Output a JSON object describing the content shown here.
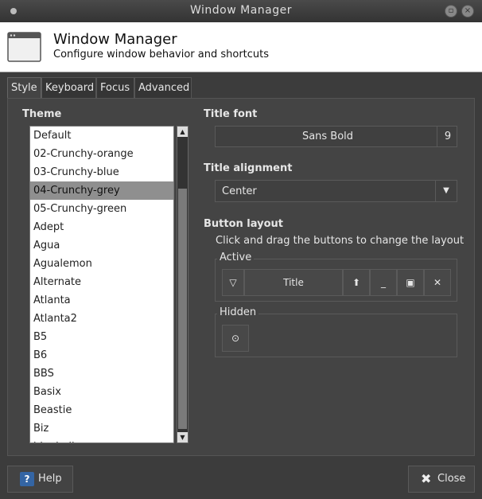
{
  "window": {
    "title": "Window Manager"
  },
  "header": {
    "title": "Window Manager",
    "subtitle": "Configure window behavior and shortcuts"
  },
  "tabs": [
    {
      "label": "Style"
    },
    {
      "label": "Keyboard"
    },
    {
      "label": "Focus"
    },
    {
      "label": "Advanced"
    }
  ],
  "style": {
    "theme_label": "Theme",
    "themes": [
      "Default",
      "02-Crunchy-orange",
      "03-Crunchy-blue",
      "04-Crunchy-grey",
      "05-Crunchy-green",
      "Adept",
      "Agua",
      "Agualemon",
      "Alternate",
      "Atlanta",
      "Atlanta2",
      "B5",
      "B6",
      "BBS",
      "Basix",
      "Beastie",
      "Biz",
      "bluebell"
    ],
    "selected_theme": "04-Crunchy-grey",
    "title_font_label": "Title font",
    "title_font_name": "Sans Bold",
    "title_font_size": "9",
    "title_alignment_label": "Title alignment",
    "title_alignment_value": "Center",
    "button_layout_label": "Button layout",
    "button_layout_hint": "Click and drag the buttons to change the layout",
    "active_label": "Active",
    "active_title": "Title",
    "hidden_label": "Hidden"
  },
  "footer": {
    "help_label": "Help",
    "close_label": "Close"
  },
  "colors": {
    "selection": "#8f8f8f",
    "background": "#3c3c3c",
    "help_icon": "#3465a4"
  },
  "icons": {
    "menu": "window-menu-icon",
    "maximize": "maximize-icon",
    "close": "close-icon",
    "app": "window-manager-icon",
    "menu_button": "triangle-down-icon",
    "shade": "shade-icon",
    "minimize": "minimize-icon",
    "maximize_btn": "maximize-icon",
    "close_btn": "close-icon",
    "stick": "stick-icon",
    "help": "help-icon"
  }
}
